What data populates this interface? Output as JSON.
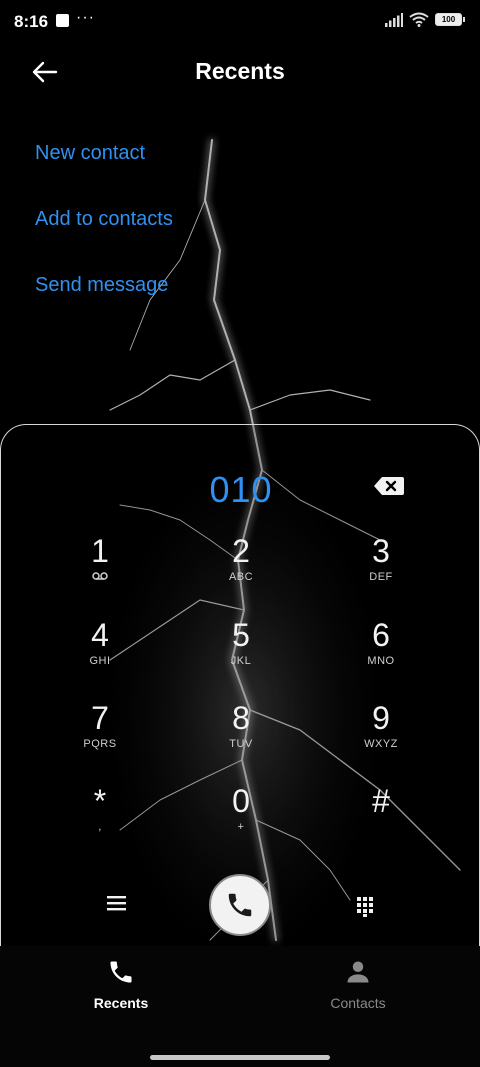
{
  "status_bar": {
    "time": "8:16",
    "dots": "···",
    "battery": "100"
  },
  "header": {
    "title": "Recents"
  },
  "actions": [
    {
      "label": "New contact"
    },
    {
      "label": "Add to contacts"
    },
    {
      "label": "Send message"
    }
  ],
  "dialer": {
    "number": "010",
    "keys": [
      {
        "digit": "1",
        "letters": ""
      },
      {
        "digit": "2",
        "letters": "ABC"
      },
      {
        "digit": "3",
        "letters": "DEF"
      },
      {
        "digit": "4",
        "letters": "GHI"
      },
      {
        "digit": "5",
        "letters": "JKL"
      },
      {
        "digit": "6",
        "letters": "MNO"
      },
      {
        "digit": "7",
        "letters": "PQRS"
      },
      {
        "digit": "8",
        "letters": "TUV"
      },
      {
        "digit": "9",
        "letters": "WXYZ"
      },
      {
        "digit": "*",
        "letters": ","
      },
      {
        "digit": "0",
        "letters": "+"
      },
      {
        "digit": "#",
        "letters": ""
      }
    ]
  },
  "bottom_nav": {
    "tabs": [
      {
        "label": "Recents",
        "icon": "phone-icon",
        "active": true
      },
      {
        "label": "Contacts",
        "icon": "person-icon",
        "active": false
      }
    ]
  },
  "colors": {
    "accent": "#2f91f0",
    "background": "#000000"
  }
}
